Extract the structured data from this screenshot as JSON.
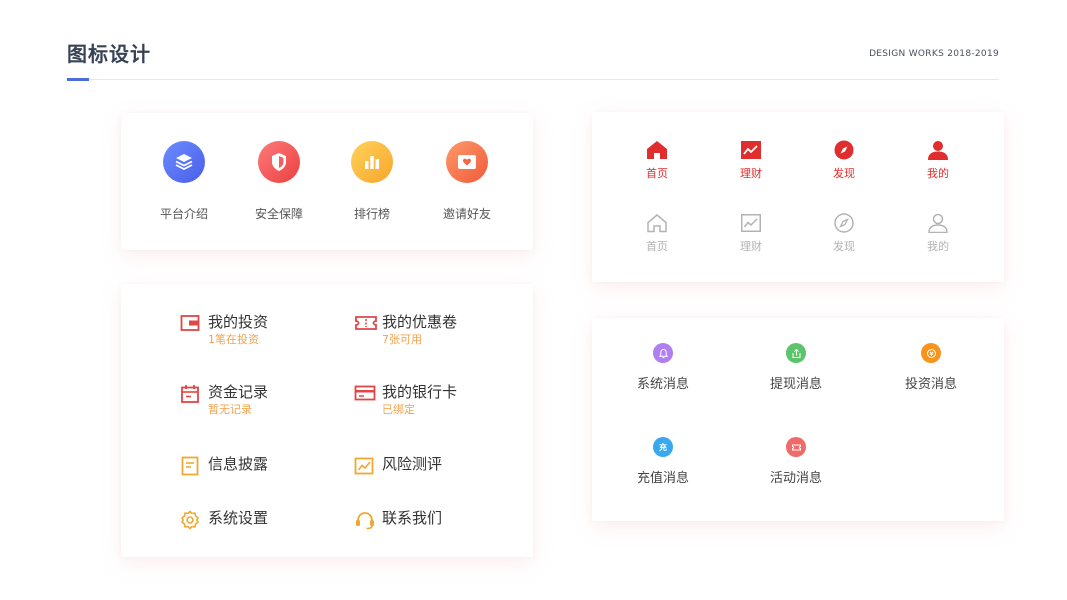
{
  "header": {
    "title": "图标设计",
    "subtitle": "DESIGN WORKS 2018-2019",
    "accent_color": "#4a6ee0"
  },
  "features": [
    {
      "label": "平台介绍",
      "icon": "layers-icon",
      "color_from": "#6b8cff",
      "color_to": "#4a5ee8"
    },
    {
      "label": "安全保障",
      "icon": "shield-icon",
      "color_from": "#ff7a7a",
      "color_to": "#ea4040"
    },
    {
      "label": "排行榜",
      "icon": "bar-chart-icon",
      "color_from": "#ffd25a",
      "color_to": "#f7a52b"
    },
    {
      "label": "邀请好友",
      "icon": "envelope-heart-icon",
      "color_from": "#ff9a6a",
      "color_to": "#f05a3a"
    }
  ],
  "tabbar": {
    "active_color": "#e02d2d",
    "inactive_color": "#b3b3b3",
    "active": [
      {
        "label": "首页",
        "icon": "home-icon"
      },
      {
        "label": "理财",
        "icon": "trend-chart-icon"
      },
      {
        "label": "发现",
        "icon": "compass-icon"
      },
      {
        "label": "我的",
        "icon": "user-icon"
      }
    ],
    "inactive": [
      {
        "label": "首页",
        "icon": "home-outline-icon"
      },
      {
        "label": "理财",
        "icon": "trend-chart-outline-icon"
      },
      {
        "label": "发现",
        "icon": "compass-outline-icon"
      },
      {
        "label": "我的",
        "icon": "user-outline-icon"
      }
    ]
  },
  "menu": {
    "items": [
      {
        "title": "我的投资",
        "sub": "1笔在投资",
        "icon": "wallet-icon"
      },
      {
        "title": "我的优惠卷",
        "sub": "7张可用",
        "icon": "coupon-icon"
      },
      {
        "title": "资金记录",
        "sub": "暂无记录",
        "icon": "calendar-icon"
      },
      {
        "title": "我的银行卡",
        "sub": "已绑定",
        "icon": "bank-card-icon"
      },
      {
        "title": "信息披露",
        "sub": "",
        "icon": "document-icon"
      },
      {
        "title": "风险测评",
        "sub": "",
        "icon": "risk-chart-icon"
      },
      {
        "title": "系统设置",
        "sub": "",
        "icon": "gear-icon"
      },
      {
        "title": "联系我们",
        "sub": "",
        "icon": "headset-icon"
      }
    ],
    "sub_color": "#f0a24b"
  },
  "messages": [
    {
      "label": "系统消息",
      "icon": "bell-icon",
      "color": "#b07ef0"
    },
    {
      "label": "提现消息",
      "icon": "withdraw-icon",
      "color": "#5cc46a"
    },
    {
      "label": "投资消息",
      "icon": "invest-icon",
      "color": "#f7941d"
    },
    {
      "label": "充值消息",
      "icon": "recharge-icon",
      "color": "#3aa8f0",
      "glyph": "充"
    },
    {
      "label": "活动消息",
      "icon": "ticket-icon",
      "color": "#f06a6a"
    }
  ]
}
